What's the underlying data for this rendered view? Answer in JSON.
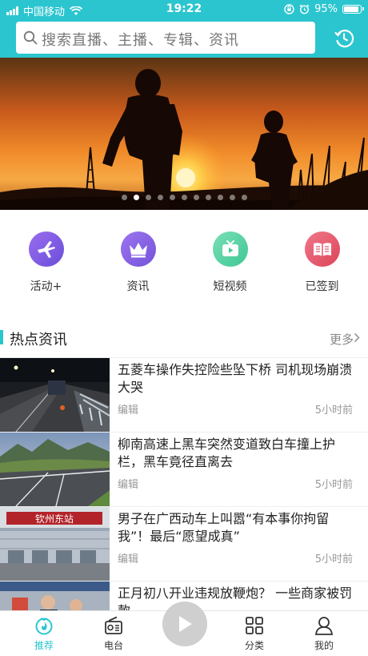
{
  "status": {
    "carrier": "中国移动",
    "time": "19:22",
    "battery": "95%",
    "battery_level": 0.95
  },
  "search": {
    "placeholder": "搜索直播、主播、专辑、资讯"
  },
  "banner": {
    "slide_count": 11,
    "active_index": 1
  },
  "quick": [
    {
      "label": "活动+",
      "icon": "airplane-icon",
      "color": "#7b5be0"
    },
    {
      "label": "资讯",
      "icon": "crown-icon",
      "color": "#8a63e3"
    },
    {
      "label": "短视频",
      "icon": "tv-play-icon",
      "color": "#5fd3a6"
    },
    {
      "label": "已签到",
      "icon": "book-icon",
      "color": "#e85a6b"
    }
  ],
  "section": {
    "title": "热点资讯",
    "more": "更多"
  },
  "news": [
    {
      "title": "五菱车操作失控险些坠下桥 司机现场崩溃大哭",
      "source": "编辑",
      "time": "5小时前"
    },
    {
      "title": "柳南高速上黑车突然变道致白车撞上护栏，黑车竟径直离去",
      "source": "编辑",
      "time": "5小时前"
    },
    {
      "title": "男子在广西动车上叫嚣“有本事你拘留我”！最后“愿望成真”",
      "source": "编辑",
      "time": "5小时前"
    },
    {
      "title": "正月初八开业违规放鞭炮？ 一些商家被罚款",
      "source": "",
      "time": ""
    }
  ],
  "news3_sign": "钦州东站",
  "tabs": [
    {
      "label": "推荐"
    },
    {
      "label": "电台"
    },
    {
      "label": "分类"
    },
    {
      "label": "我的"
    }
  ],
  "colors": {
    "accent": "#2bc5cf"
  }
}
